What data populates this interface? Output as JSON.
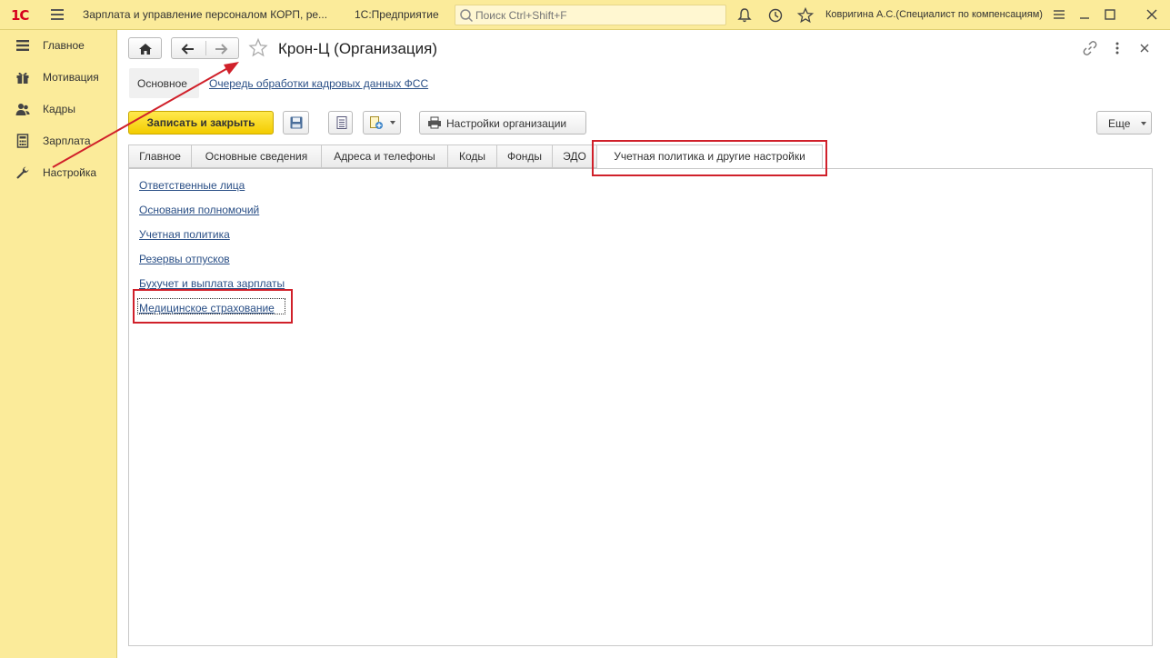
{
  "topbar": {
    "logo": "1С",
    "app_title": "Зарплата и управление персоналом КОРП, ре...",
    "platform": "1С:Предприятие",
    "search_placeholder": "Поиск Ctrl+Shift+F",
    "user": "Ковригина А.С.(Специалист по компенсациям)"
  },
  "sidebar": {
    "items": [
      {
        "label": "Главное",
        "icon": "hamburger-icon"
      },
      {
        "label": "Мотивация",
        "icon": "gift-icon"
      },
      {
        "label": "Кадры",
        "icon": "people-icon"
      },
      {
        "label": "Зарплата",
        "icon": "calculator-icon"
      },
      {
        "label": "Настройка",
        "icon": "wrench-icon"
      }
    ]
  },
  "form": {
    "title": "Крон-Ц (Организация)",
    "subtabs": {
      "active": "Основное",
      "link": "Очередь обработки кадровых данных ФСС"
    },
    "toolbar": {
      "save_close": "Записать и закрыть",
      "org_settings": "Настройки организации",
      "more": "Еще"
    },
    "tabs": [
      "Главное",
      "Основные сведения",
      "Адреса и телефоны",
      "Коды",
      "Фонды",
      "ЭДО",
      "Учетная политика и другие настройки"
    ],
    "active_tab_index": 6,
    "links": [
      "Ответственные лица",
      "Основания полномочий",
      "Учетная политика",
      "Резервы отпусков",
      "Бухучет и выплата зарплаты",
      "Медицинское страхование"
    ]
  },
  "colors": {
    "topbar_bg": "#fbeb9a",
    "primary_button": "#f5d200",
    "link": "#2a4f86",
    "annotation": "#d0202a"
  }
}
